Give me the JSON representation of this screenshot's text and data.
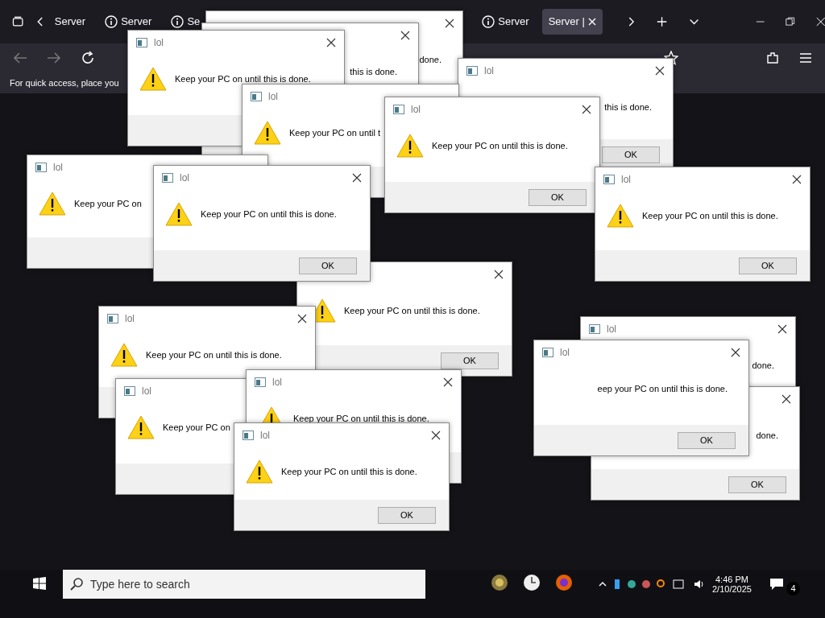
{
  "browser": {
    "tabs": [
      {
        "label": "Server",
        "selected": false
      },
      {
        "label": "Server",
        "selected": false
      },
      {
        "label": "Se",
        "selected": false
      },
      {
        "label": "Server",
        "selected": false
      },
      {
        "label": "Server |",
        "selected": true
      }
    ],
    "bookmarks_hint": "For quick access, place you"
  },
  "dialogs": [
    {
      "kind": "tail",
      "message": "done."
    },
    {
      "kind": "tail",
      "message": "this is done."
    },
    {
      "kind": "normal",
      "title": "lol",
      "message": "Keep your PC on until this is done."
    },
    {
      "kind": "normal",
      "title": "lol",
      "message": "Keep your PC on until t"
    },
    {
      "kind": "tail",
      "title": "lol",
      "message": "this is done.",
      "ok": "OK"
    },
    {
      "kind": "normal",
      "title": "lol",
      "message": "Keep your PC on until this is done.",
      "ok": "OK"
    },
    {
      "kind": "normal",
      "title": "lol",
      "message": "Keep your PC on"
    },
    {
      "kind": "normal",
      "title": "lol",
      "message": "Keep your PC on until this is done.",
      "ok": "OK"
    },
    {
      "kind": "normal",
      "title": "lol",
      "message": "Keep your PC on until this is done.",
      "ok": "OK"
    },
    {
      "kind": "normal",
      "title": "lol",
      "message": "Keep your PC on until this is done."
    },
    {
      "kind": "normal",
      "message": "Keep your PC on until this is done.",
      "ok": "OK"
    },
    {
      "kind": "tail",
      "title": "lol",
      "message": "done."
    },
    {
      "kind": "tail",
      "title": "lol",
      "message": "eep your PC on until this is done.",
      "ok": "OK"
    },
    {
      "kind": "normal",
      "title": "lol",
      "message": "Keep your PC on until this is done."
    },
    {
      "kind": "normal",
      "title": "lol",
      "message": "Keep your PC on"
    },
    {
      "kind": "normal",
      "title": "lol",
      "message": "Keep your PC on until this is done.",
      "ok": "OK"
    },
    {
      "kind": "tail",
      "message": "done.",
      "ok": "OK"
    }
  ],
  "taskbar": {
    "search_placeholder": "Type here to search",
    "time": "4:46 PM",
    "date": "2/10/2025",
    "notifications": "4"
  }
}
